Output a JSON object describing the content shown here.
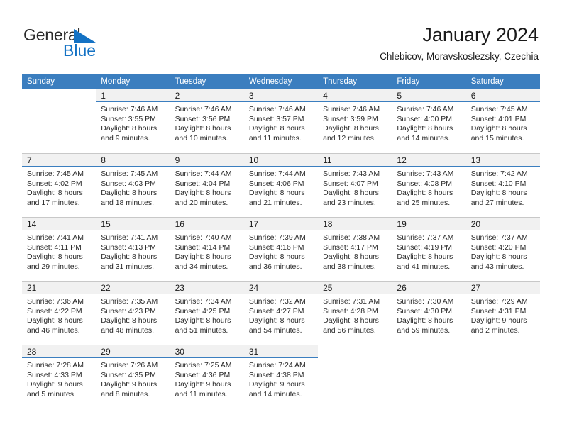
{
  "brand": {
    "name_top": "General",
    "name_bottom": "Blue",
    "triangle_color": "#1472c4",
    "text_color": "#2b2b2b"
  },
  "header": {
    "title": "January 2024",
    "subtitle": "Chlebicov, Moravskoslezsky, Czechia"
  },
  "theme": {
    "header_blue": "#3b7ebf",
    "daynum_band": "#f1f1f1",
    "grid_line": "#c8c8c8",
    "text": "#1a1a1a"
  },
  "weekdays": [
    "Sunday",
    "Monday",
    "Tuesday",
    "Wednesday",
    "Thursday",
    "Friday",
    "Saturday"
  ],
  "weeks": [
    [
      {
        "empty": true
      },
      {
        "day": "1",
        "sunrise": "Sunrise: 7:46 AM",
        "sunset": "Sunset: 3:55 PM",
        "daylight1": "Daylight: 8 hours",
        "daylight2": "and 9 minutes."
      },
      {
        "day": "2",
        "sunrise": "Sunrise: 7:46 AM",
        "sunset": "Sunset: 3:56 PM",
        "daylight1": "Daylight: 8 hours",
        "daylight2": "and 10 minutes."
      },
      {
        "day": "3",
        "sunrise": "Sunrise: 7:46 AM",
        "sunset": "Sunset: 3:57 PM",
        "daylight1": "Daylight: 8 hours",
        "daylight2": "and 11 minutes."
      },
      {
        "day": "4",
        "sunrise": "Sunrise: 7:46 AM",
        "sunset": "Sunset: 3:59 PM",
        "daylight1": "Daylight: 8 hours",
        "daylight2": "and 12 minutes."
      },
      {
        "day": "5",
        "sunrise": "Sunrise: 7:46 AM",
        "sunset": "Sunset: 4:00 PM",
        "daylight1": "Daylight: 8 hours",
        "daylight2": "and 14 minutes."
      },
      {
        "day": "6",
        "sunrise": "Sunrise: 7:45 AM",
        "sunset": "Sunset: 4:01 PM",
        "daylight1": "Daylight: 8 hours",
        "daylight2": "and 15 minutes."
      }
    ],
    [
      {
        "day": "7",
        "sunrise": "Sunrise: 7:45 AM",
        "sunset": "Sunset: 4:02 PM",
        "daylight1": "Daylight: 8 hours",
        "daylight2": "and 17 minutes."
      },
      {
        "day": "8",
        "sunrise": "Sunrise: 7:45 AM",
        "sunset": "Sunset: 4:03 PM",
        "daylight1": "Daylight: 8 hours",
        "daylight2": "and 18 minutes."
      },
      {
        "day": "9",
        "sunrise": "Sunrise: 7:44 AM",
        "sunset": "Sunset: 4:04 PM",
        "daylight1": "Daylight: 8 hours",
        "daylight2": "and 20 minutes."
      },
      {
        "day": "10",
        "sunrise": "Sunrise: 7:44 AM",
        "sunset": "Sunset: 4:06 PM",
        "daylight1": "Daylight: 8 hours",
        "daylight2": "and 21 minutes."
      },
      {
        "day": "11",
        "sunrise": "Sunrise: 7:43 AM",
        "sunset": "Sunset: 4:07 PM",
        "daylight1": "Daylight: 8 hours",
        "daylight2": "and 23 minutes."
      },
      {
        "day": "12",
        "sunrise": "Sunrise: 7:43 AM",
        "sunset": "Sunset: 4:08 PM",
        "daylight1": "Daylight: 8 hours",
        "daylight2": "and 25 minutes."
      },
      {
        "day": "13",
        "sunrise": "Sunrise: 7:42 AM",
        "sunset": "Sunset: 4:10 PM",
        "daylight1": "Daylight: 8 hours",
        "daylight2": "and 27 minutes."
      }
    ],
    [
      {
        "day": "14",
        "sunrise": "Sunrise: 7:41 AM",
        "sunset": "Sunset: 4:11 PM",
        "daylight1": "Daylight: 8 hours",
        "daylight2": "and 29 minutes."
      },
      {
        "day": "15",
        "sunrise": "Sunrise: 7:41 AM",
        "sunset": "Sunset: 4:13 PM",
        "daylight1": "Daylight: 8 hours",
        "daylight2": "and 31 minutes."
      },
      {
        "day": "16",
        "sunrise": "Sunrise: 7:40 AM",
        "sunset": "Sunset: 4:14 PM",
        "daylight1": "Daylight: 8 hours",
        "daylight2": "and 34 minutes."
      },
      {
        "day": "17",
        "sunrise": "Sunrise: 7:39 AM",
        "sunset": "Sunset: 4:16 PM",
        "daylight1": "Daylight: 8 hours",
        "daylight2": "and 36 minutes."
      },
      {
        "day": "18",
        "sunrise": "Sunrise: 7:38 AM",
        "sunset": "Sunset: 4:17 PM",
        "daylight1": "Daylight: 8 hours",
        "daylight2": "and 38 minutes."
      },
      {
        "day": "19",
        "sunrise": "Sunrise: 7:37 AM",
        "sunset": "Sunset: 4:19 PM",
        "daylight1": "Daylight: 8 hours",
        "daylight2": "and 41 minutes."
      },
      {
        "day": "20",
        "sunrise": "Sunrise: 7:37 AM",
        "sunset": "Sunset: 4:20 PM",
        "daylight1": "Daylight: 8 hours",
        "daylight2": "and 43 minutes."
      }
    ],
    [
      {
        "day": "21",
        "sunrise": "Sunrise: 7:36 AM",
        "sunset": "Sunset: 4:22 PM",
        "daylight1": "Daylight: 8 hours",
        "daylight2": "and 46 minutes."
      },
      {
        "day": "22",
        "sunrise": "Sunrise: 7:35 AM",
        "sunset": "Sunset: 4:23 PM",
        "daylight1": "Daylight: 8 hours",
        "daylight2": "and 48 minutes."
      },
      {
        "day": "23",
        "sunrise": "Sunrise: 7:34 AM",
        "sunset": "Sunset: 4:25 PM",
        "daylight1": "Daylight: 8 hours",
        "daylight2": "and 51 minutes."
      },
      {
        "day": "24",
        "sunrise": "Sunrise: 7:32 AM",
        "sunset": "Sunset: 4:27 PM",
        "daylight1": "Daylight: 8 hours",
        "daylight2": "and 54 minutes."
      },
      {
        "day": "25",
        "sunrise": "Sunrise: 7:31 AM",
        "sunset": "Sunset: 4:28 PM",
        "daylight1": "Daylight: 8 hours",
        "daylight2": "and 56 minutes."
      },
      {
        "day": "26",
        "sunrise": "Sunrise: 7:30 AM",
        "sunset": "Sunset: 4:30 PM",
        "daylight1": "Daylight: 8 hours",
        "daylight2": "and 59 minutes."
      },
      {
        "day": "27",
        "sunrise": "Sunrise: 7:29 AM",
        "sunset": "Sunset: 4:31 PM",
        "daylight1": "Daylight: 9 hours",
        "daylight2": "and 2 minutes."
      }
    ],
    [
      {
        "day": "28",
        "sunrise": "Sunrise: 7:28 AM",
        "sunset": "Sunset: 4:33 PM",
        "daylight1": "Daylight: 9 hours",
        "daylight2": "and 5 minutes."
      },
      {
        "day": "29",
        "sunrise": "Sunrise: 7:26 AM",
        "sunset": "Sunset: 4:35 PM",
        "daylight1": "Daylight: 9 hours",
        "daylight2": "and 8 minutes."
      },
      {
        "day": "30",
        "sunrise": "Sunrise: 7:25 AM",
        "sunset": "Sunset: 4:36 PM",
        "daylight1": "Daylight: 9 hours",
        "daylight2": "and 11 minutes."
      },
      {
        "day": "31",
        "sunrise": "Sunrise: 7:24 AM",
        "sunset": "Sunset: 4:38 PM",
        "daylight1": "Daylight: 9 hours",
        "daylight2": "and 14 minutes."
      },
      {
        "empty": true
      },
      {
        "empty": true
      },
      {
        "empty": true
      }
    ]
  ]
}
